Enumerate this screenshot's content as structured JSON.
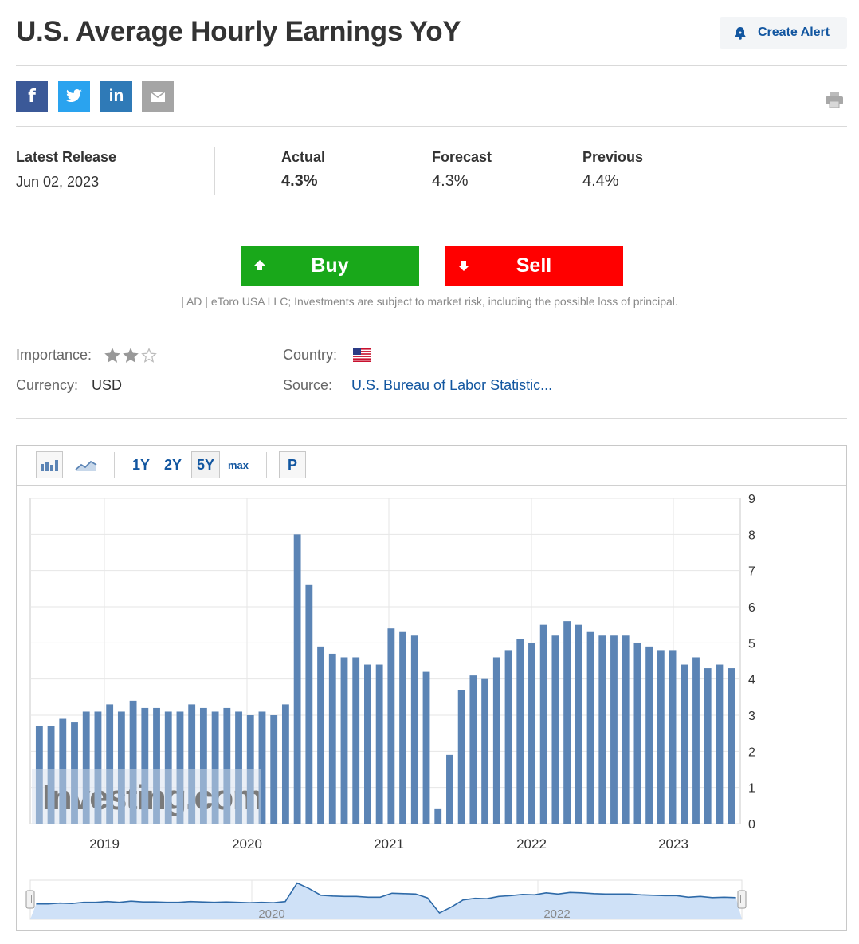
{
  "page_title": "U.S. Average Hourly Earnings YoY",
  "create_alert_label": "Create Alert",
  "share": {
    "facebook": "f",
    "twitter": "twitter-bird",
    "linkedin": "in",
    "email": "mail-icon"
  },
  "release": {
    "latest_label": "Latest Release",
    "latest_date": "Jun 02, 2023",
    "actual_label": "Actual",
    "actual_value": "4.3%",
    "forecast_label": "Forecast",
    "forecast_value": "4.3%",
    "previous_label": "Previous",
    "previous_value": "4.4%"
  },
  "trade": {
    "buy_label": "Buy",
    "sell_label": "Sell",
    "buy_color": "#19a81a",
    "sell_color": "#ff0000",
    "disclaimer": "| AD | eToro USA LLC; Investments are subject to market risk, including the possible loss of principal."
  },
  "info": {
    "importance_label": "Importance:",
    "importance_stars": 2,
    "importance_max": 3,
    "country_label": "Country:",
    "country_flag": "us-flag-icon",
    "currency_label": "Currency:",
    "currency_value": "USD",
    "source_label": "Source:",
    "source_value": "U.S. Bureau of Labor Statistic..."
  },
  "chart_toolbar": {
    "ranges": [
      "1Y",
      "2Y",
      "5Y",
      "max"
    ],
    "active_range": "5Y",
    "p_label": "P"
  },
  "watermark": "Investing.com",
  "chart_data": {
    "type": "bar",
    "x_tick_labels": [
      "2019",
      "2020",
      "2021",
      "2022",
      "2023"
    ],
    "ylim": [
      0,
      9
    ],
    "y_ticks": [
      0,
      1,
      2,
      3,
      4,
      5,
      6,
      7,
      8,
      9
    ],
    "grid": true,
    "bar_color": "#5b84b5",
    "values": [
      2.7,
      2.7,
      2.9,
      2.8,
      3.1,
      3.1,
      3.3,
      3.1,
      3.4,
      3.2,
      3.2,
      3.1,
      3.1,
      3.3,
      3.2,
      3.1,
      3.2,
      3.1,
      3.0,
      3.1,
      3.0,
      3.3,
      8.0,
      6.6,
      4.9,
      4.7,
      4.6,
      4.6,
      4.4,
      4.4,
      5.4,
      5.3,
      5.2,
      4.2,
      0.4,
      1.9,
      3.7,
      4.1,
      4.0,
      4.6,
      4.8,
      5.1,
      5.0,
      5.5,
      5.2,
      5.6,
      5.5,
      5.3,
      5.2,
      5.2,
      5.2,
      5.0,
      4.9,
      4.8,
      4.8,
      4.4,
      4.6,
      4.3,
      4.4,
      4.3
    ],
    "navigator_labels": [
      "2020",
      "2022"
    ]
  }
}
